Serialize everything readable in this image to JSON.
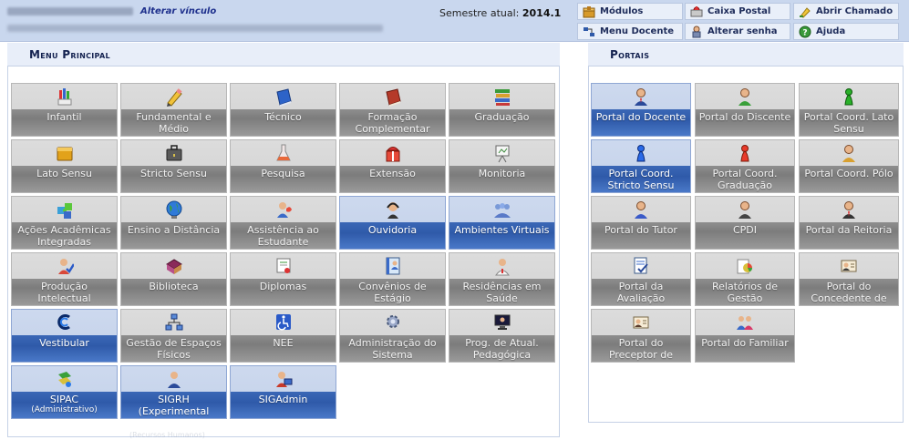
{
  "header": {
    "alter_link": "Alterar vínculo",
    "semestre_label": "Semestre atual:",
    "semestre_value": "2014.1",
    "buttons": [
      {
        "label": "Módulos",
        "icon": "modules-icon"
      },
      {
        "label": "Caixa Postal",
        "icon": "mailbox-icon"
      },
      {
        "label": "Abrir Chamado",
        "icon": "ticket-icon"
      },
      {
        "label": "Menu Docente",
        "icon": "teacher-menu-icon"
      },
      {
        "label": "Alterar senha",
        "icon": "password-icon"
      },
      {
        "label": "Ajuda",
        "icon": "help-icon"
      }
    ]
  },
  "menu_principal": {
    "title": "Menu Principal",
    "rows": [
      [
        {
          "label": "Infantil",
          "icon": "crayons-icon"
        },
        {
          "label": "Fundamental e Médio",
          "icon": "pencil-icon"
        },
        {
          "label": "Técnico",
          "icon": "blue-book-icon"
        },
        {
          "label": "Formação Complementar",
          "icon": "red-book-icon"
        },
        {
          "label": "Graduação",
          "icon": "books-stack-icon"
        }
      ],
      [
        {
          "label": "Lato Sensu",
          "icon": "folder-icon"
        },
        {
          "label": "Stricto Sensu",
          "icon": "briefcase-icon"
        },
        {
          "label": "Pesquisa",
          "icon": "flask-icon"
        },
        {
          "label": "Extensão",
          "icon": "gift-icon"
        },
        {
          "label": "Monitoria",
          "icon": "whiteboard-icon"
        }
      ],
      [
        {
          "label": "Ações Acadêmicas Integradas",
          "icon": "puzzle-icon"
        },
        {
          "label": "Ensino a Distância",
          "icon": "globe-icon"
        },
        {
          "label": "Assistência ao Estudante",
          "icon": "student-assist-icon"
        },
        {
          "label": "Ouvidoria",
          "icon": "headset-icon",
          "highlighted": true
        },
        {
          "label": "Ambientes Virtuais",
          "icon": "people-group-icon",
          "highlighted": true
        }
      ],
      [
        {
          "label": "Produção Intelectual",
          "icon": "producer-icon"
        },
        {
          "label": "Biblioteca",
          "icon": "library-icon"
        },
        {
          "label": "Diplomas",
          "icon": "diploma-icon"
        },
        {
          "label": "Convênios de Estágio",
          "icon": "agenda-icon"
        },
        {
          "label": "Residências em Saúde",
          "icon": "doctor-icon"
        }
      ],
      [
        {
          "label": "Vestibular",
          "icon": "vestibular-logo-icon",
          "highlighted": true
        },
        {
          "label": "Gestão de Espaços Físicos",
          "icon": "network-icon"
        },
        {
          "label": "NEE",
          "icon": "accessibility-icon"
        },
        {
          "label": "Administração do Sistema",
          "icon": "gear-icon"
        },
        {
          "label": "Prog. de Atual. Pedagógica",
          "icon": "monitor-icon"
        }
      ],
      [
        {
          "label": "SIPAC",
          "sub": "(Administrativo)",
          "icon": "sipac-icon",
          "highlighted": true
        },
        {
          "label": "SIGRH (Experimental",
          "ghost": "(Recursos Humanos)",
          "icon": "sigrh-person-icon",
          "highlighted": true
        },
        {
          "label": "SIGAdmin",
          "icon": "sigadmin-icon",
          "highlighted": true
        }
      ]
    ]
  },
  "portais": {
    "title": "Portais",
    "rows": [
      [
        {
          "label": "Portal do Docente",
          "icon": "teacher-person-icon",
          "highlighted": true
        },
        {
          "label": "Portal do Discente",
          "icon": "student-person-icon"
        },
        {
          "label": "Portal Coord. Lato Sensu",
          "icon": "green-pawn-icon"
        }
      ],
      [
        {
          "label": "Portal Coord. Stricto Sensu",
          "icon": "blue-pawn-icon",
          "highlighted": true
        },
        {
          "label": "Portal Coord. Graduação",
          "icon": "red-pawn-icon"
        },
        {
          "label": "Portal Coord. Pólo",
          "icon": "polo-person-icon"
        }
      ],
      [
        {
          "label": "Portal do Tutor",
          "icon": "tutor-person-icon"
        },
        {
          "label": "CPDI",
          "icon": "cpdi-person-icon"
        },
        {
          "label": "Portal da Reitoria",
          "icon": "rector-person-icon"
        }
      ],
      [
        {
          "label": "Portal da Avaliação Institucional",
          "icon": "evaluation-icon"
        },
        {
          "label": "Relatórios de Gestão",
          "icon": "reports-icon"
        },
        {
          "label": "Portal do Concedente de Estágio",
          "icon": "id-card-icon"
        }
      ],
      [
        {
          "label": "Portal do Preceptor de Estágio",
          "icon": "preceptor-card-icon"
        },
        {
          "label": "Portal do Familiar",
          "icon": "family-icon"
        }
      ]
    ]
  }
}
